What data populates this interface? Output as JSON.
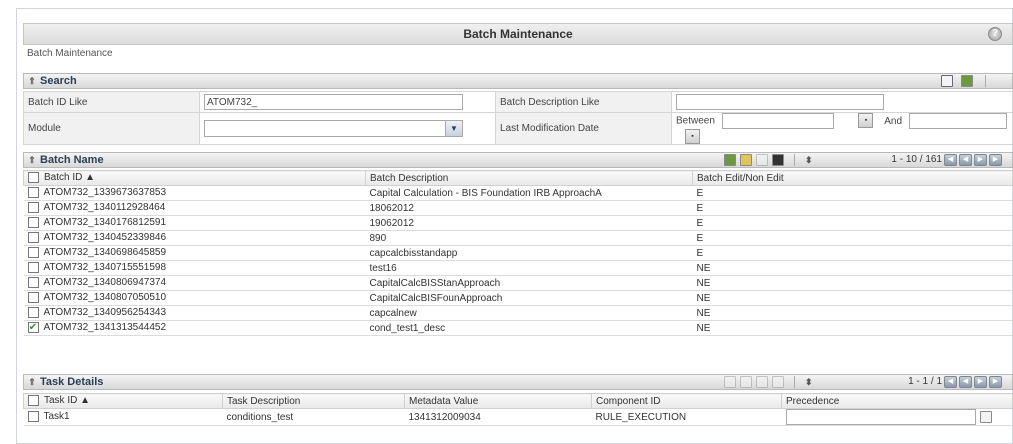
{
  "page": {
    "title": "Batch Maintenance",
    "breadcrumb": "Batch Maintenance",
    "help_icon": "help-icon"
  },
  "search": {
    "header": "Search",
    "batch_id_label": "Batch ID Like",
    "batch_id_value": "ATOM732_",
    "batch_desc_label": "Batch Description Like",
    "batch_desc_value": "",
    "module_label": "Module",
    "module_value": "",
    "last_mod_label": "Last Modification Date",
    "between_label": "Between",
    "and_label": "And",
    "between_value": "",
    "and_value": ""
  },
  "batch": {
    "header": "Batch Name",
    "pager_text": "1 - 10 / 161",
    "columns": [
      "Batch ID ▲",
      "Batch Description",
      "Batch Edit/Non Edit"
    ],
    "rows": [
      {
        "id": "ATOM732_1339673637853",
        "desc": "Capital Calculation - BIS Foundation IRB ApproachA",
        "edit": "E",
        "checked": false
      },
      {
        "id": "ATOM732_1340112928464",
        "desc": "18062012",
        "edit": "E",
        "checked": false
      },
      {
        "id": "ATOM732_1340176812591",
        "desc": "19062012",
        "edit": "E",
        "checked": false
      },
      {
        "id": "ATOM732_1340452339846",
        "desc": "890",
        "edit": "E",
        "checked": false
      },
      {
        "id": "ATOM732_1340698645859",
        "desc": "capcalcbisstandapp",
        "edit": "E",
        "checked": false
      },
      {
        "id": "ATOM732_1340715551598",
        "desc": "test16",
        "edit": "NE",
        "checked": false
      },
      {
        "id": "ATOM732_1340806947374",
        "desc": "CapitalCalcBISStanApproach",
        "edit": "NE",
        "checked": false
      },
      {
        "id": "ATOM732_1340807050510",
        "desc": "CapitalCalcBISFounApproach",
        "edit": "NE",
        "checked": false
      },
      {
        "id": "ATOM732_1340956254343",
        "desc": "capcalnew",
        "edit": "NE",
        "checked": false
      },
      {
        "id": "ATOM732_1341313544452",
        "desc": "cond_test1_desc",
        "edit": "NE",
        "checked": true
      }
    ]
  },
  "tasks": {
    "header": "Task Details",
    "pager_text": "1 - 1 / 1",
    "columns": [
      "Task ID ▲",
      "Task Description",
      "Metadata Value",
      "Component ID",
      "Precedence"
    ],
    "rows": [
      {
        "id": "Task1",
        "desc": "conditions_test",
        "meta": "1341312009034",
        "comp": "RULE_EXECUTION",
        "prec": ""
      }
    ]
  },
  "colors": {
    "header_text": "#2b3f55",
    "check": "#3c8d2f"
  }
}
